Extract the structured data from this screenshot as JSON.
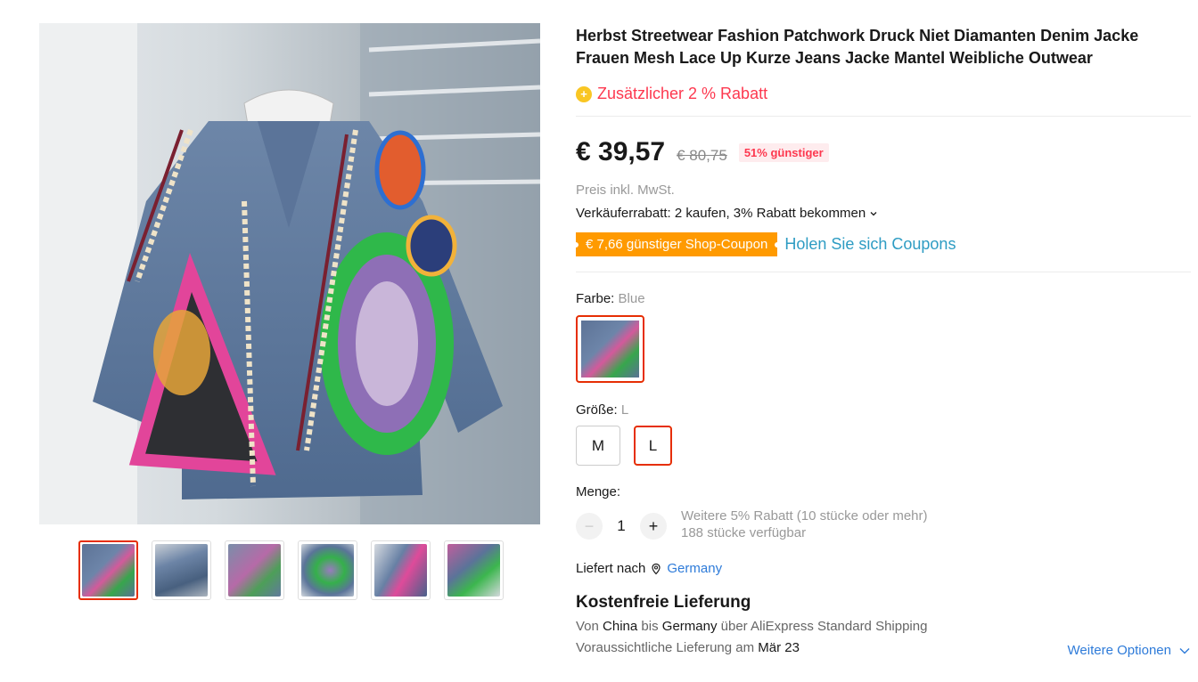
{
  "product": {
    "title": "Herbst Streetwear Fashion Patchwork Druck Niet Diamanten Denim Jacke Frauen Mesh Lace Up Kurze Jeans Jacke Mantel Weibliche Outwear",
    "extra_discount": "Zusätzlicher 2 % Rabatt",
    "price": "€ 39,57",
    "original_price": "€ 80,75",
    "discount_badge": "51% günstiger",
    "tax_note": "Preis inkl. MwSt.",
    "seller_discount": "Verkäuferrabatt: 2 kaufen, 3% Rabatt bekommen",
    "coupon_label": "€ 7,66 günstiger Shop-Coupon",
    "coupon_link": "Holen Sie sich Coupons"
  },
  "color": {
    "label": "Farbe:",
    "value": "Blue"
  },
  "size": {
    "label": "Größe:",
    "value": "L",
    "options": [
      "M",
      "L"
    ]
  },
  "quantity": {
    "label": "Menge:",
    "value": "1",
    "minus": "−",
    "plus": "+",
    "bulk_note": "Weitere 5% Rabatt (10 stücke oder mehr)",
    "stock_note": "188 stücke verfügbar"
  },
  "shipping": {
    "ship_to_label": "Liefert nach",
    "country": "Germany",
    "free_title": "Kostenfreie Lieferung",
    "route_from_word": "Von",
    "route_from": "China",
    "route_to_word": "bis",
    "route_to": "Germany",
    "route_via": "über AliExpress Standard Shipping",
    "eta_label": "Voraussichtliche Lieferung am",
    "eta_date": "Mär 23",
    "more_options": "Weitere Optionen"
  },
  "colors": {
    "accent_red": "#e62e04",
    "price_red": "#fd384f",
    "coupon_orange": "#ff9a00",
    "link_blue": "#2e7bd9"
  }
}
